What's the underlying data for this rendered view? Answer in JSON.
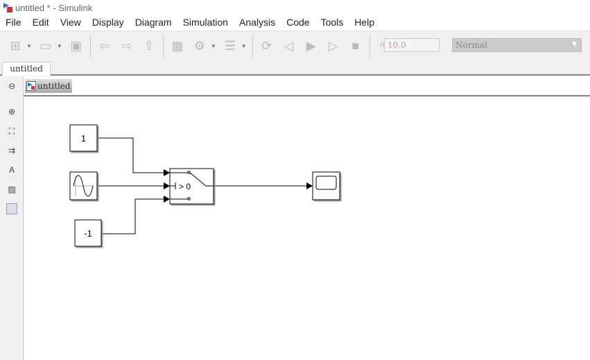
{
  "window": {
    "title": "untitled * - Simulink"
  },
  "menu": [
    "File",
    "Edit",
    "View",
    "Display",
    "Diagram",
    "Simulation",
    "Analysis",
    "Code",
    "Tools",
    "Help"
  ],
  "toolbar": {
    "stop_time": "10.0",
    "sim_mode": "Normal"
  },
  "tabs": [
    {
      "label": "untitled"
    }
  ],
  "breadcrumb": {
    "label": "untitled"
  },
  "diagram": {
    "blocks": [
      {
        "type": "Constant",
        "value": "1"
      },
      {
        "type": "Sine Wave"
      },
      {
        "type": "Constant",
        "value": "-1"
      },
      {
        "type": "Switch",
        "criteria": "> 0"
      },
      {
        "type": "Scope"
      }
    ]
  },
  "colors": {
    "line": "#000000",
    "canvas": "#ffffff"
  }
}
